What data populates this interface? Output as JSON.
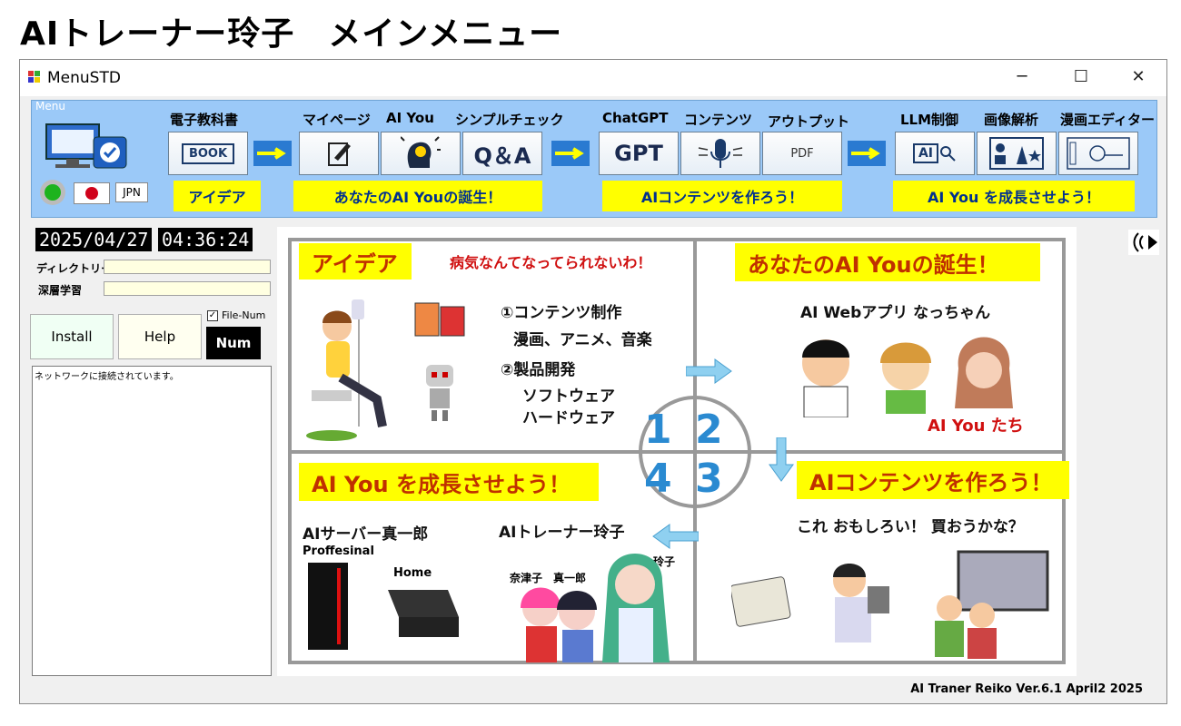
{
  "page_title": "AIトレーナー玲子　メインメニュー",
  "window": {
    "title": "MenuSTD",
    "minimize": "─",
    "maximize": "☐",
    "close": "✕"
  },
  "menu": {
    "legend": "Menu",
    "jpn": "JPN",
    "buttons": [
      {
        "label": "電子教科書",
        "text": "BOOK"
      },
      {
        "label": "マイページ",
        "text": ""
      },
      {
        "label": "AI You",
        "text": ""
      },
      {
        "label": "シンプルチェック",
        "text": "Q＆A"
      },
      {
        "label": "ChatGPT",
        "text": "GPT"
      },
      {
        "label": "コンテンツ",
        "text": ""
      },
      {
        "label": "アウトプット",
        "text": "PDF"
      },
      {
        "label": "LLM制御",
        "text": "AI"
      },
      {
        "label": "画像解析",
        "text": ""
      },
      {
        "label": "漫画エディター",
        "text": ""
      }
    ],
    "banners": [
      "アイデア",
      "あなたのAI Youの誕生！",
      "AIコンテンツを作ろう！",
      "AI You を成長させよう！"
    ]
  },
  "status": {
    "date": "2025/04/27",
    "time": "04:36:24",
    "dir_label": "ディレクトリー",
    "deep_label": "深層学習",
    "file_num_label": "File-Num",
    "install": "Install",
    "help": "Help",
    "num": "Num",
    "log": "ネットワークに接続されています。"
  },
  "poster": {
    "q1_title": "アイデア",
    "q1_quote": "病気なんてなってられないわ！",
    "q1_item1": "①コンテンツ制作",
    "q1_item1_sub": "漫画、アニメ、音楽",
    "q1_item2": "②製品開発",
    "q1_item2_sub1": "ソフトウェア",
    "q1_item2_sub2": "ハードウェア",
    "q2_title": "あなたのAI Youの誕生！",
    "q2_app": "AI Webアプリ なっちゃん",
    "q2_footer": "AI You たち",
    "q3_title": "AIコンテンツを作ろう！",
    "q3_quote": "これ おもしろい！ 買おうかな？",
    "q4_title": "AI You を成長させよう！",
    "q4_server": "AIサーバー真一郎",
    "q4_prof": "Proffesinal",
    "q4_home": "Home",
    "q4_trainer": "AIトレーナー玲子",
    "q4_names": "奈津子　真一郎",
    "q4_reiko": "玲子",
    "n1": "1",
    "n2": "2",
    "n3": "3",
    "n4": "4"
  },
  "footer": "AI Traner Reiko Ver.6.1 April2 2025",
  "colors": {
    "menu_bg": "#9bc9f8",
    "banner": "#ffff00",
    "arrow": "#2a7ad1",
    "accent": "#2a8ad1"
  }
}
